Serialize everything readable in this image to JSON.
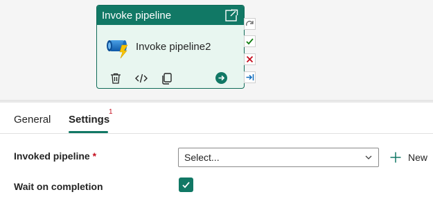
{
  "canvas": {
    "activity": {
      "header_title": "Invoke pipeline",
      "name": "Invoke pipeline2",
      "icon": "invoke-pipeline-icon",
      "actions": [
        "delete-icon",
        "code-icon",
        "copy-icon",
        "run-arrow-icon"
      ]
    },
    "ports": [
      "skipped-icon",
      "success-check-icon",
      "failure-x-icon",
      "completion-arrow-icon"
    ]
  },
  "tabs": [
    {
      "label": "General",
      "active": false
    },
    {
      "label": "Settings",
      "active": true,
      "badge": "1"
    }
  ],
  "form": {
    "invoked_pipeline": {
      "label": "Invoked pipeline",
      "required_mark": "*",
      "placeholder": "Select...",
      "new_label": "New"
    },
    "wait_on_completion": {
      "label": "Wait on completion",
      "checked": true
    }
  },
  "colors": {
    "accent": "#117865",
    "card_bg": "#e8f6f0",
    "required": "#c50f1f",
    "success": "#107c10",
    "failure": "#c50f1f",
    "completion": "#0f6cbd",
    "skipped": "#707070"
  }
}
